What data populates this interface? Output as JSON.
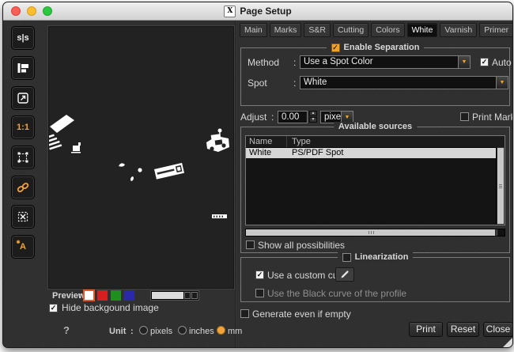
{
  "window": {
    "title": "Page Setup"
  },
  "sidebar": {
    "items": [
      {
        "name": "mirror",
        "label": "s|s"
      },
      {
        "name": "align",
        "label": ""
      },
      {
        "name": "export",
        "label": ""
      },
      {
        "name": "actual-size",
        "label": "1:1"
      },
      {
        "name": "selection-frame",
        "label": ""
      },
      {
        "name": "link",
        "label": ""
      },
      {
        "name": "frame-clear",
        "label": ""
      },
      {
        "name": "annotate",
        "label": "A"
      }
    ]
  },
  "tabs": {
    "items": [
      "Main",
      "Marks",
      "S&R",
      "Cutting",
      "Colors",
      "White",
      "Varnish",
      "Primer"
    ],
    "active": "White"
  },
  "separation": {
    "legend": "Enable Separation",
    "enabled": true,
    "method_label": "Method",
    "colon": ":",
    "method_value": "Use a Spot Color",
    "auto_label": "Auto",
    "auto_checked": true,
    "spot_label": "Spot",
    "spot_value": "White"
  },
  "adjust": {
    "label": "Adjust",
    "colon": ":",
    "value": "0.00",
    "unit": "pixel",
    "print_marks_label": "Print Marks",
    "print_marks_checked": false
  },
  "sources": {
    "legend": "Available sources",
    "columns": [
      "Name",
      "Type"
    ],
    "rows": [
      {
        "name": "White",
        "type": "PS/PDF Spot",
        "selected": true
      }
    ],
    "show_all_label": "Show all possibilities",
    "show_all_checked": false
  },
  "linearization": {
    "legend": "Linearization",
    "checked": false,
    "custom_curve_label": "Use a custom curve",
    "custom_curve_checked": true,
    "black_curve_label": "Use the Black curve of the profile",
    "black_curve_checked": false
  },
  "generate": {
    "label": "Generate even if empty",
    "checked": false
  },
  "actions": {
    "print": "Print",
    "reset": "Reset",
    "close": "Close"
  },
  "preview": {
    "label": "Preview",
    "colon": ":",
    "swatches": [
      "#ffffff",
      "#d81f1f",
      "#1e8f1e",
      "#2a2aa8"
    ],
    "selected_swatch": "#ffffff",
    "hide_bg_label": "Hide backgound image",
    "hide_bg_checked": true
  },
  "unit": {
    "help": "?",
    "label": "Unit",
    "colon": ":",
    "options": [
      "pixels",
      "inches",
      "mm"
    ],
    "selected": "mm"
  },
  "icons": {
    "check": "✓",
    "dropdown_arrow": "▼",
    "spin_up": "▲",
    "spin_down": "▼",
    "app_glyph": "X",
    "sparkle": "✱"
  },
  "colors": {
    "accent_orange": "#f2a33c",
    "selected_swatch_border": "#e05a2b",
    "selection_gray": "#d6d6d6",
    "canvas_bg": "#222222",
    "traffic_lights": [
      "#f95f57",
      "#fbbe2e",
      "#2bc840"
    ]
  }
}
